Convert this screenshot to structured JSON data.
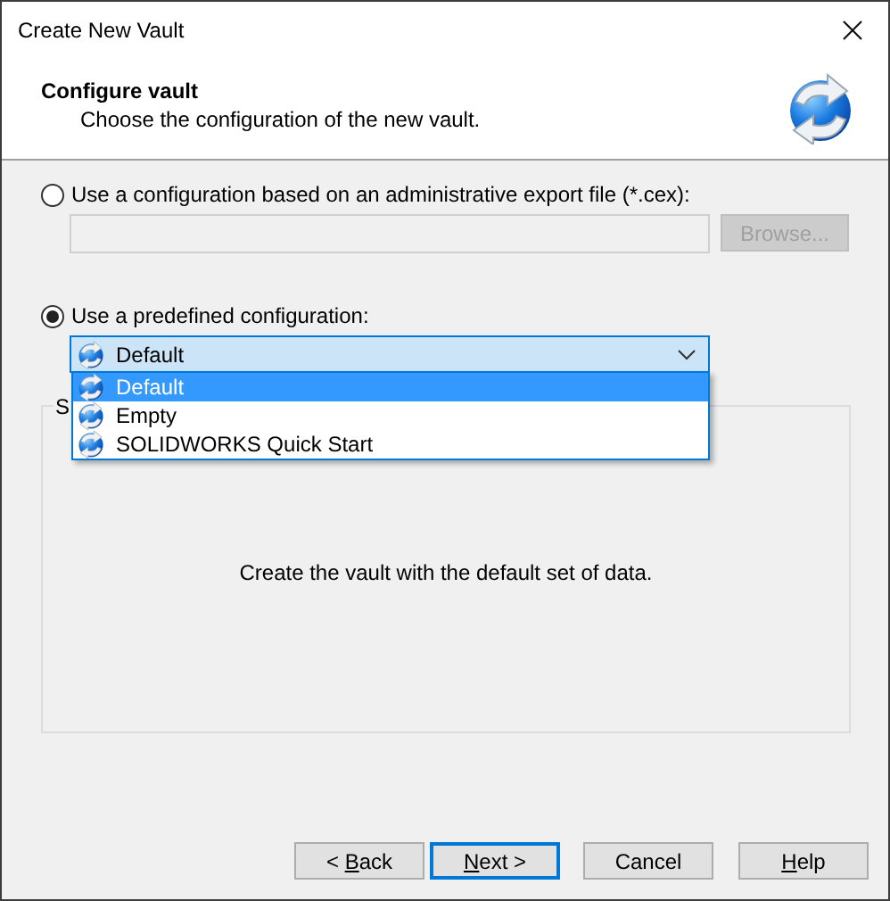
{
  "window": {
    "title": "Create New Vault"
  },
  "header": {
    "title": "Configure vault",
    "subtitle": "Choose the configuration of the new vault."
  },
  "options": [
    {
      "kind": "file",
      "label": "Use a configuration based on an administrative export file (*.cex):",
      "selected": false,
      "browse": {
        "label": "Browse...",
        "disabled": true
      }
    },
    {
      "kind": "combo",
      "label": "Use a predefined configuration:",
      "selected": true,
      "combo": {
        "value": "Default",
        "expanded": true,
        "items": [
          {
            "label": "Default",
            "selected": true
          },
          {
            "label": "Empty",
            "selected": false
          },
          {
            "label": "SOLIDWORKS Quick Start",
            "selected": false
          }
        ]
      }
    }
  ],
  "group": {
    "title": "S",
    "description": "Create the vault with the default set of data."
  },
  "buttons": [
    {
      "pre": "< ",
      "key": "B",
      "post": "ack",
      "default": false
    },
    {
      "key": "N",
      "post": "ext >",
      "default": true
    },
    {
      "pre": "Cancel",
      "default": false
    },
    {
      "key": "H",
      "post": "elp",
      "default": false
    }
  ]
}
